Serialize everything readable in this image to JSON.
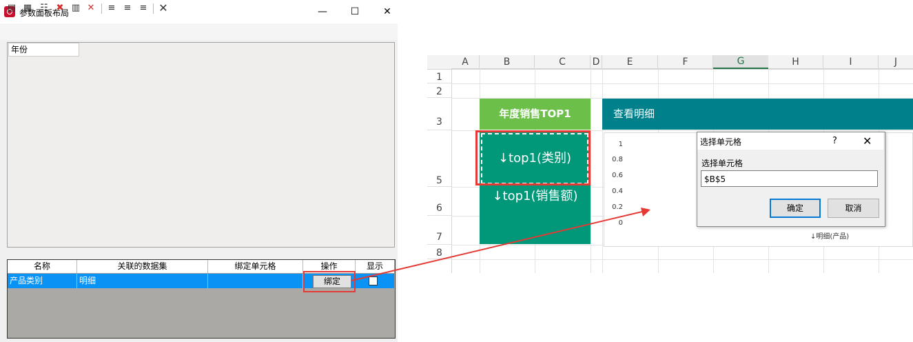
{
  "window": {
    "title": "参数面板布局",
    "minimize": "—",
    "maximize": "☐",
    "close": "✕"
  },
  "toolbar": {
    "icons": [
      "insert-row-icon",
      "insert-col-icon",
      "add-param-icon",
      "delete-param-icon",
      "merge-icon",
      "delete-icon",
      "align-left-icon",
      "align-center-icon",
      "align-right-icon",
      "clear-icon"
    ]
  },
  "param_panel": {
    "label": "年份"
  },
  "grid": {
    "headers": [
      "名称",
      "关联的数据集",
      "绑定单元格",
      "操作",
      "显示"
    ],
    "row": {
      "name": "产品类别",
      "dataset": "明细",
      "cell": "",
      "action": "绑定"
    }
  },
  "sheet": {
    "columns": [
      "A",
      "B",
      "C",
      "D",
      "E",
      "F",
      "G",
      "H",
      "I",
      "J"
    ],
    "rows": [
      "1",
      "2",
      "3",
      "5",
      "6",
      "7",
      "8"
    ],
    "title1": "年度销售TOP1",
    "title2": "查看明细",
    "b5": "↓top1(类别)",
    "b6": "↓top1(销售额)",
    "chart": {
      "yticks": [
        "1",
        "0.8",
        "0.6",
        "0.4",
        "0.2",
        "0"
      ],
      "xlabel": "↓明细(产品)"
    }
  },
  "dialog": {
    "title": "选择单元格",
    "help": "?",
    "close": "✕",
    "label": "选择单元格",
    "value": "$B$5",
    "ok": "确定",
    "cancel": "取消"
  },
  "colors": {
    "accent_red": "#e53935",
    "green": "#6cc04a",
    "teal": "#019879",
    "dark_teal": "#00808a",
    "selection_blue": "#0a93f5"
  }
}
